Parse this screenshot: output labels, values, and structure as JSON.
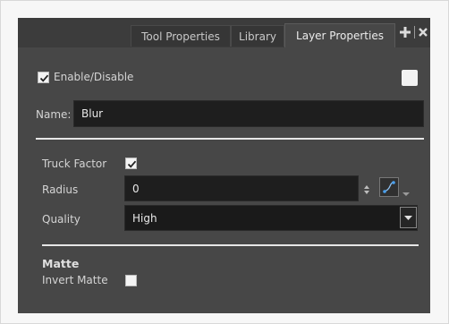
{
  "tabs": [
    {
      "label": "Tool Properties",
      "active": false
    },
    {
      "label": "Library",
      "active": false
    },
    {
      "label": "Layer Properties",
      "active": true
    }
  ],
  "toolbar_icons": [
    "add-icon",
    "close-icon"
  ],
  "enable": {
    "label": "Enable/Disable",
    "checked": true
  },
  "name": {
    "label": "Name:",
    "value": "Blur"
  },
  "truck_factor": {
    "label": "Truck Factor",
    "checked": true
  },
  "radius": {
    "label": "Radius",
    "value": "0"
  },
  "quality": {
    "label": "Quality",
    "value": "High"
  },
  "matte": {
    "heading": "Matte",
    "invert_label": "Invert Matte",
    "invert_checked": false
  },
  "colors": {
    "panel": "#3c3c3c",
    "content": "#474747",
    "field": "#1e1e1e",
    "accent": "#2a7fd4"
  }
}
